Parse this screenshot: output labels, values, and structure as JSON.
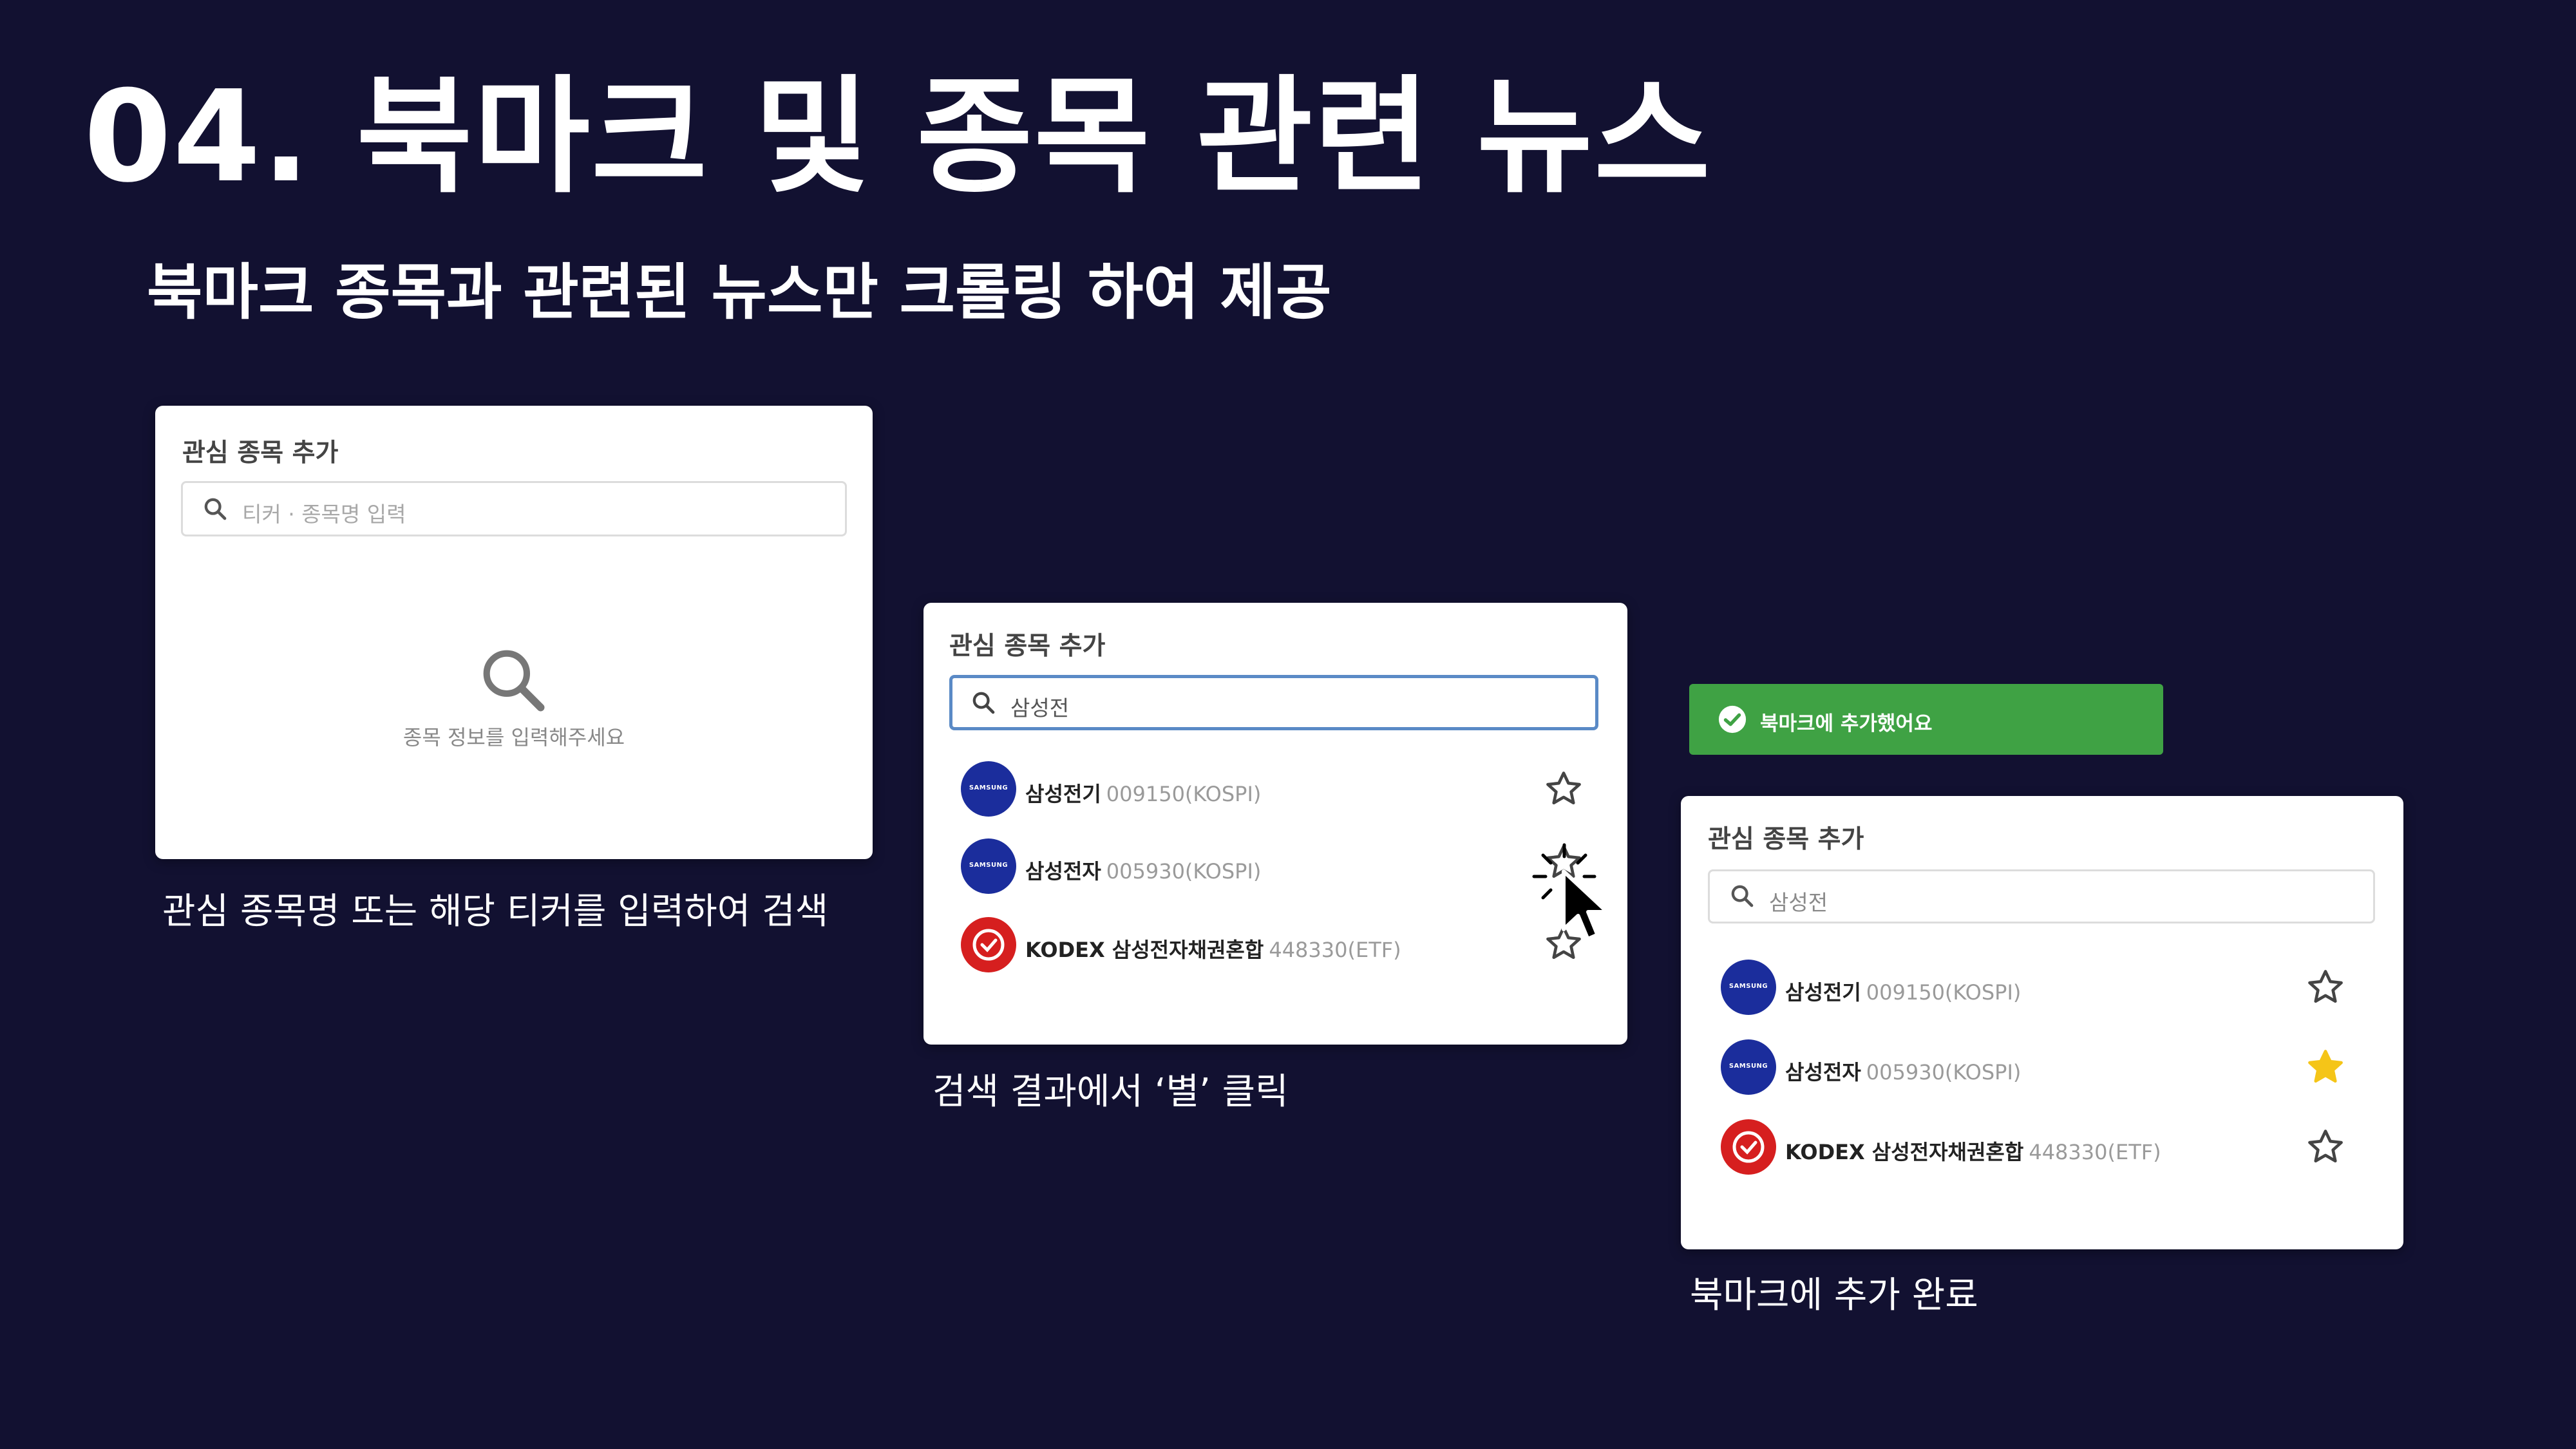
{
  "page": {
    "title": "04. 북마크 및 종목 관련 뉴스",
    "subtitle": "북마크 종목과 관련된 뉴스만 크롤링 하여 제공"
  },
  "panel1": {
    "title": "관심 종목 추가",
    "search_placeholder": "티커 · 종목명 입력",
    "empty_message": "종목 정보를 입력해주세요",
    "caption": "관심 종목명 또는 해당 티커를 입력하여 검색"
  },
  "panel2": {
    "title": "관심 종목 추가",
    "search_value": "삼성전",
    "caption": "검색 결과에서 ‘별’ 클릭",
    "results": [
      {
        "name": "삼성전기",
        "code": "009150(KOSPI)",
        "logo": "samsung",
        "starred": false
      },
      {
        "name": "삼성전자",
        "code": "005930(KOSPI)",
        "logo": "samsung",
        "starred": false
      },
      {
        "name": "KODEX 삼성전자채권혼합",
        "code": "448330(ETF)",
        "logo": "kodex",
        "starred": false
      }
    ]
  },
  "panel3": {
    "toast": "북마크에 추가했어요",
    "title": "관심 종목 추가",
    "search_value": "삼성전",
    "caption": "북마크에 추가 완료",
    "results": [
      {
        "name": "삼성전기",
        "code": "009150(KOSPI)",
        "logo": "samsung",
        "starred": false
      },
      {
        "name": "삼성전자",
        "code": "005930(KOSPI)",
        "logo": "samsung",
        "starred": true
      },
      {
        "name": "KODEX 삼성전자채권혼합",
        "code": "448330(ETF)",
        "logo": "kodex",
        "starred": false
      }
    ]
  },
  "logos": {
    "samsung_text": "SAMSUNG"
  },
  "colors": {
    "background": "#121131",
    "toast": "#3fa244",
    "star_filled": "#f5c518",
    "search_focus": "#5a8ac6",
    "samsung_logo": "#1b2d9c",
    "kodex_logo": "#d61f1f"
  }
}
